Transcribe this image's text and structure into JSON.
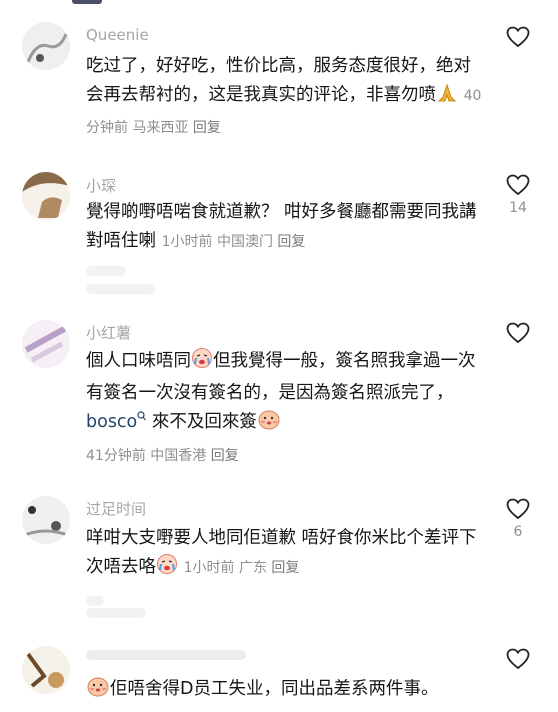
{
  "comments": [
    {
      "username": "Queenie",
      "text": "吃过了，好好吃，性价比高，服务态度很好，绝对会再去帮衬的，这是我真实的评论，非喜勿喷",
      "time": "40分钟前",
      "location": "马来西亚",
      "reply_label": "回复",
      "likes": ""
    },
    {
      "username": "小琛",
      "text": "覺得啲嘢唔啱食就道歉？ 咁好多餐廳都需要同我講對唔住喇",
      "time": "1小时前",
      "location": "中国澳门",
      "reply_label": "回复",
      "likes": "14"
    },
    {
      "username": "小红薯",
      "text_a": "個人口味唔同",
      "text_b": "但我覺得一般，簽名照我拿過一次有簽名一次沒有簽名的，是因為簽名照派完了，",
      "mention": "bosco",
      "text_c": "來不及回來簽",
      "time": "41分钟前",
      "location": "中国香港",
      "reply_label": "回复",
      "likes": ""
    },
    {
      "username": "过足时间",
      "text": "咩咁大支嘢要人地同佢道歉 唔好食你米比个差评下次唔去咯",
      "time": "1小时前",
      "location": "广东",
      "reply_label": "回复",
      "likes": "6"
    },
    {
      "username": "",
      "text": "佢唔舍得D员工失业，同出品差系两件事。",
      "likes": ""
    }
  ],
  "icons": {
    "like": "heart-outline-icon",
    "pray": "praying-hands-emoji",
    "laugh_cry": "crying-face-emoji",
    "search": "search-mini-icon"
  },
  "colors": {
    "text": "#161616",
    "meta": "#8f8f8f",
    "mention": "#26456e"
  }
}
